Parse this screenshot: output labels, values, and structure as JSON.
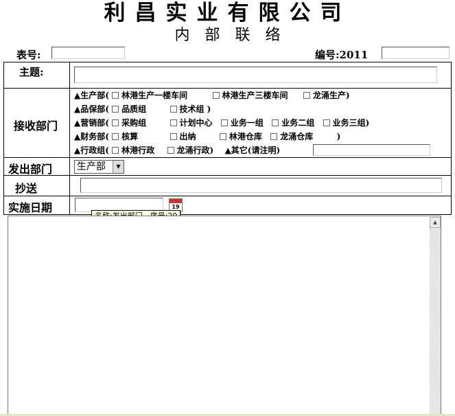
{
  "header": {
    "company": "利昌实业有限公司",
    "subtitle": "内　部　联　络",
    "form_no_label": "表号:",
    "form_no_value": "",
    "serial_label": "编号:2011",
    "serial_value": ""
  },
  "rows": {
    "subject_label": "主题:",
    "subject_value": "",
    "receive_label": "接收部门",
    "send_label": "发出部门",
    "send_selected": "生产部",
    "cc_label": "抄送",
    "cc_value": "",
    "date_label": "实施日期",
    "date_value": "",
    "calendar_day": "19"
  },
  "departments": [
    {
      "head": "▲生产部(",
      "items": [
        "林港生产一楼车间",
        "林港生产三楼车间",
        "龙涌生产)"
      ]
    },
    {
      "head": "▲品保部(",
      "items": [
        "品质组",
        "技术组 )"
      ]
    },
    {
      "head": "▲营销部(",
      "items": [
        "采购组",
        "计划中心",
        "业务一组",
        "业务二组",
        "业务三组)"
      ]
    },
    {
      "head": "▲财务部(",
      "items": [
        "核算",
        "出纳",
        "林港仓库",
        "龙涌仓库"
      ],
      "tail": ")"
    },
    {
      "head": "▲行政组(",
      "items": [
        "林港行政",
        "龙涌行政)"
      ],
      "other": "▲其它(请注明)"
    }
  ],
  "tooltip": {
    "text": "名称:发出部门　序号:20"
  },
  "scrollbar": {
    "up_icon": "▲"
  }
}
